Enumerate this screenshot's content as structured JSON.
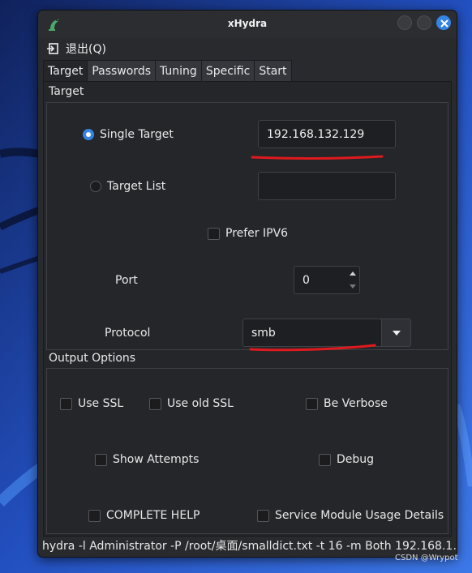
{
  "window": {
    "title": "xHydra"
  },
  "menu": {
    "quit_label": "退出(Q)"
  },
  "tabs": [
    {
      "label": "Target",
      "active": true
    },
    {
      "label": "Passwords",
      "active": false
    },
    {
      "label": "Tuning",
      "active": false
    },
    {
      "label": "Specific",
      "active": false
    },
    {
      "label": "Start",
      "active": false
    }
  ],
  "target_group": {
    "title": "Target",
    "single_target_label": "Single Target",
    "single_target_selected": true,
    "single_target_value": "192.168.132.129",
    "target_list_label": "Target List",
    "target_list_selected": false,
    "target_list_value": "",
    "prefer_ipv6_label": "Prefer IPV6",
    "prefer_ipv6_checked": false,
    "port_label": "Port",
    "port_value": "0",
    "protocol_label": "Protocol",
    "protocol_value": "smb"
  },
  "output_group": {
    "title": "Output Options",
    "use_ssl": "Use SSL",
    "use_old_ssl": "Use old SSL",
    "be_verbose": "Be Verbose",
    "show_attempts": "Show Attempts",
    "debug": "Debug",
    "complete_help": "COMPLETE HELP",
    "service_module": "Service Module Usage Details"
  },
  "status": {
    "command": "hydra -l Administrator -P /root/桌面/smalldict.txt -t 16 -m Both 192.168.1…"
  },
  "watermark": "CSDN @Wrypot",
  "colors": {
    "accent": "#3584e4",
    "annotation": "#e0191d",
    "desktop": "#1c3fa0",
    "window_bg": "#292a2e"
  },
  "icons": {
    "app": "hydra-icon",
    "quit": "exit-icon",
    "close": "close-icon",
    "combo": "chevron-down-icon"
  }
}
